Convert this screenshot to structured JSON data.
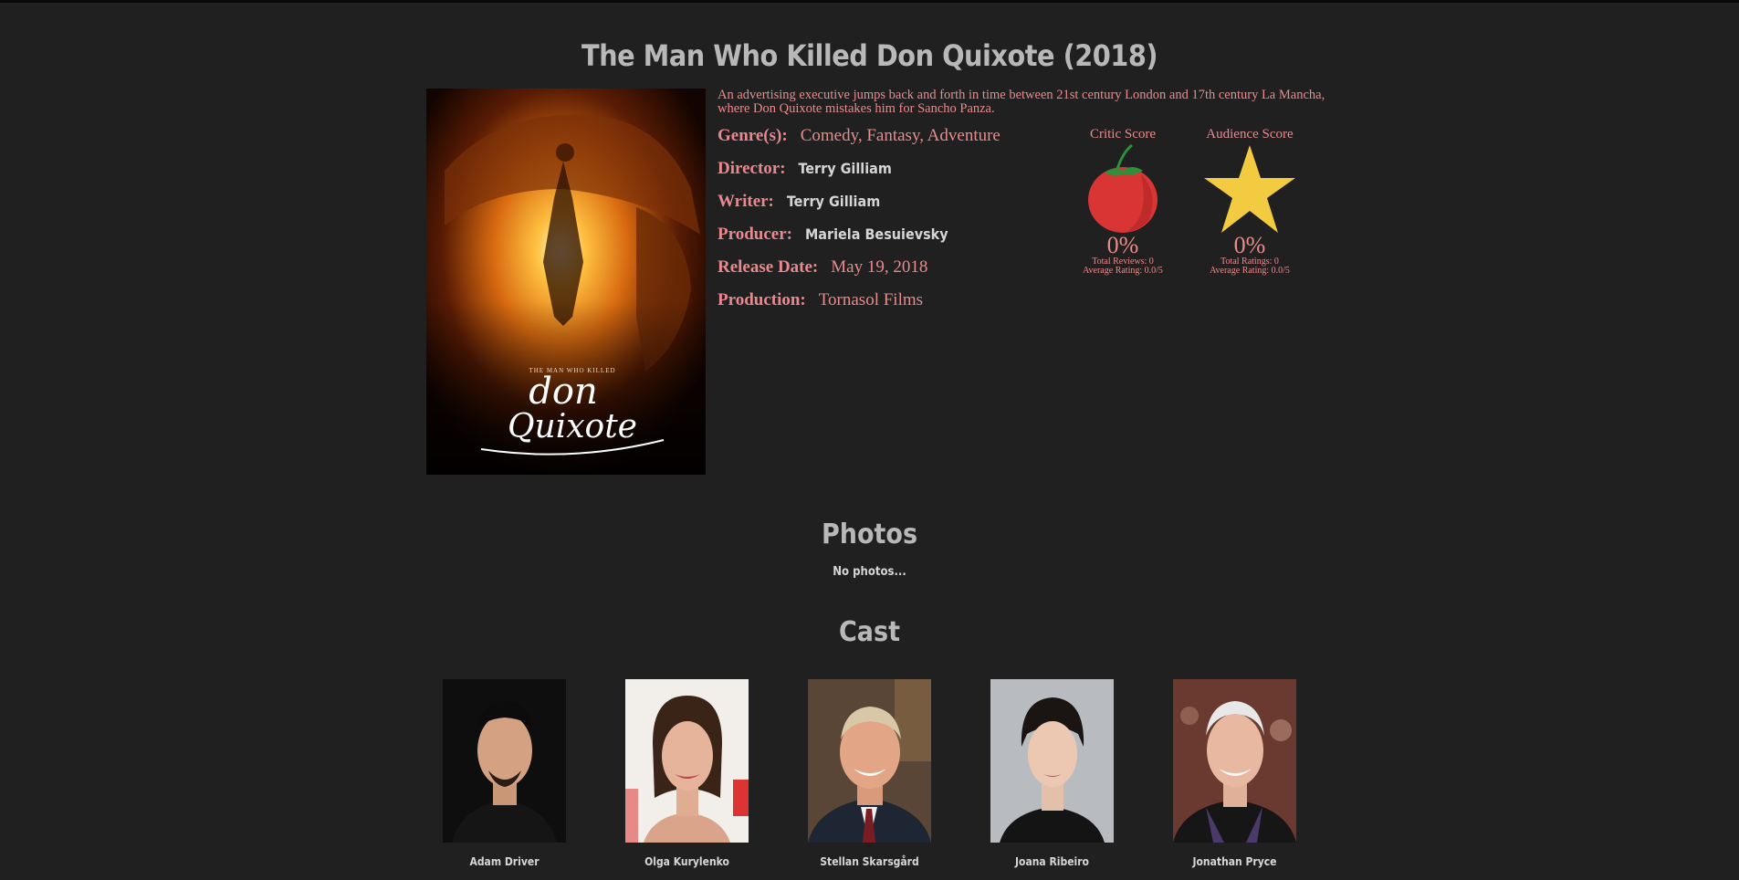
{
  "movie": {
    "title": "The Man Who Killed Don Quixote (2018)",
    "synopsis": "An advertising executive jumps back and forth in time between 21st century London and 17th century La Mancha, where Don Quixote mistakes him for Sancho Panza.",
    "poster": {
      "small_text": "THE MAN WHO KILLED",
      "script_line1": "don",
      "script_line2": "Quixote"
    }
  },
  "info": {
    "genres_label": "Genre(s):",
    "genres": "Comedy, Fantasy, Adventure",
    "director_label": "Director:",
    "director": "Terry Gilliam",
    "writer_label": "Writer:",
    "writer": "Terry Gilliam",
    "producer_label": "Producer:",
    "producer": "Mariela Besuievsky",
    "release_label": "Release Date:",
    "release": "May 19, 2018",
    "production_label": "Production:",
    "production": "Tornasol Films"
  },
  "scores": {
    "critic": {
      "heading": "Critic Score",
      "icon": "tomato-icon",
      "percent": "0%",
      "line1": "Total Reviews: 0",
      "line2": "Average Rating: 0.0/5"
    },
    "audience": {
      "heading": "Audience Score",
      "icon": "star-icon",
      "percent": "0%",
      "line1": "Total Ratings: 0",
      "line2": "Average Rating: 0.0/5"
    }
  },
  "photos": {
    "heading": "Photos",
    "empty_text": "No photos..."
  },
  "cast": {
    "heading": "Cast",
    "members": [
      {
        "name": "Adam Driver"
      },
      {
        "name": "Olga Kurylenko"
      },
      {
        "name": "Stellan Skarsgård"
      },
      {
        "name": "Joana Ribeiro"
      },
      {
        "name": "Jonathan Pryce"
      }
    ]
  },
  "colors": {
    "background": "#202020",
    "accent_text": "#e88b8b",
    "heading_text": "#b8b8b8",
    "star": "#f2cb40",
    "tomato": "#d93535"
  }
}
